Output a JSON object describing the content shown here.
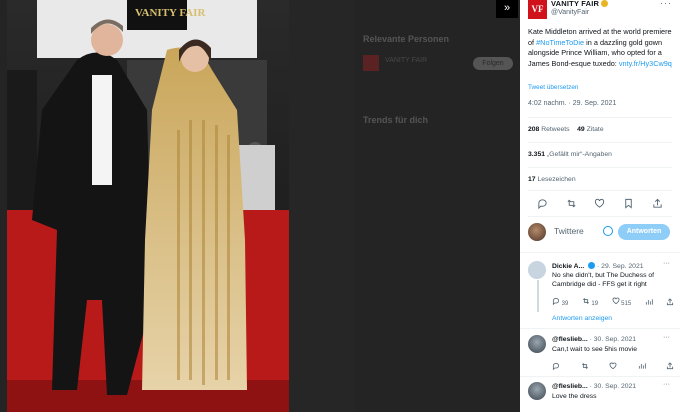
{
  "background": {
    "sections": [
      "Relevante Personen",
      "Trends für dich"
    ],
    "relevant_name": "VANITY FAIR",
    "follow_label": "Folgen"
  },
  "tweet": {
    "account_name": "VANITY FAIR",
    "account_handle": "@VanityFair",
    "logo_text": "VF",
    "text_part1": "Kate Middleton arrived at the world premiere of ",
    "hashtag": "#NoTimeToDie",
    "text_part2": " in a dazzling gold gown alongside Prince William, who opted for a James Bond-esque tuxedo: ",
    "link": "vnty.fr/Hy3Cw9q",
    "translate_label": "Tweet übersetzen",
    "timestamp": "4:02 nachm. · 29. Sep. 2021",
    "retweets_count": "208",
    "retweets_label": "Retweets",
    "quotes_count": "49",
    "quotes_label": "Zitate",
    "likes_count": "3.351",
    "likes_label": "„Gefällt mir“-Angaben",
    "bookmarks_count": "17",
    "bookmarks_label": "Lesezeichen"
  },
  "reply_box": {
    "placeholder": "Twittere",
    "button_label": "Antworten"
  },
  "replies": [
    {
      "name": "Dickie A...",
      "date": "· 29. Sep. 2021",
      "text": "No she didn't, but The Duchess of Cambridge did - FFS get it right",
      "replies": "39",
      "retweets": "19",
      "likes": "515",
      "avatar_color": "#c8d4e0"
    },
    {
      "name": "@fleslieb...",
      "date": "· 30. Sep. 2021",
      "text": "Can,t wait to see 5his movie",
      "avatar_color": "#4a5560"
    },
    {
      "name": "@fleslieb...",
      "date": "· 30. Sep. 2021",
      "text": "Love the dress",
      "avatar_color": "#4a5560"
    }
  ],
  "show_replies_label": "Antworten anzeigen",
  "more_glyph": "···",
  "expand_glyph": "»"
}
